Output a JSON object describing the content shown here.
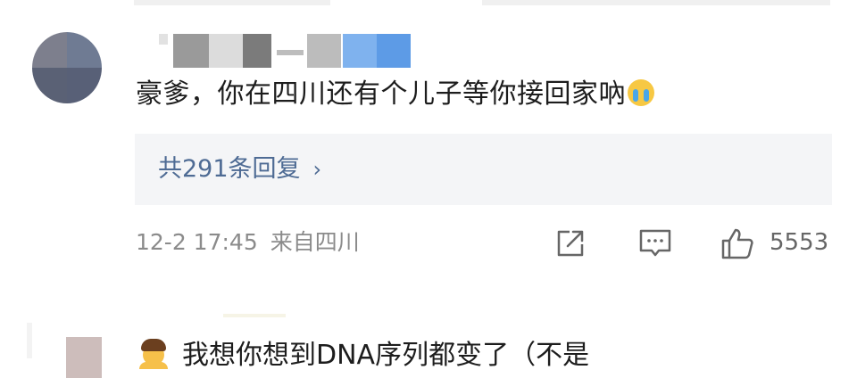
{
  "comment1": {
    "text": "豪爹，你在四川还有个儿子等你接回家吶",
    "emoji": "crying-face-icon",
    "replies_label": "共291条回复",
    "replies_chevron": "›",
    "timestamp": "12-2 17:45",
    "location": "来自四川",
    "like_count": "5553"
  },
  "comment2": {
    "emoji": "man-icon",
    "text": "我想你想到DNA序列都变了（不是"
  },
  "colors": {
    "link": "#4e6b94",
    "meta": "#8b8b8b",
    "reply_bg": "#f4f5f7"
  }
}
